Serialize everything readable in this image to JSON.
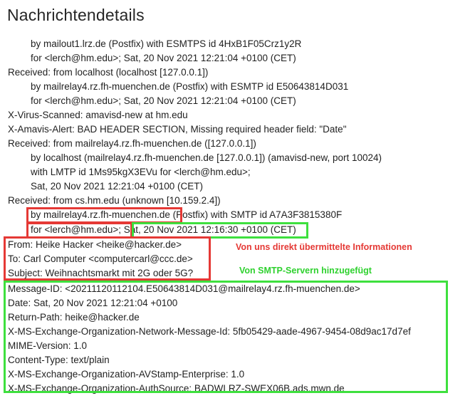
{
  "page": {
    "title": "Nachrichtendetails"
  },
  "header_lines": [
    "by mailout1.lrz.de (Postfix) with ESMTPS id 4HxB1F05Crz1y2R",
    "for <lerch@hm.edu>; Sat, 20 Nov 2021 12:21:04 +0100 (CET)",
    "Received: from localhost (localhost [127.0.0.1])",
    "by mailrelay4.rz.fh-muenchen.de (Postfix) with ESMTP id E50643814D031",
    "for <lerch@hm.edu>; Sat, 20 Nov 2021 12:21:04 +0100 (CET)",
    "X-Virus-Scanned: amavisd-new at hm.edu",
    "X-Amavis-Alert: BAD HEADER SECTION, Missing required header field: \"Date\"",
    "Received: from mailrelay4.rz.fh-muenchen.de ([127.0.0.1])",
    "by localhost (mailrelay4.rz.fh-muenchen.de [127.0.0.1]) (amavisd-new, port 10024)",
    "with LMTP id 1Ms95kgX3EVu for <lerch@hm.edu>;",
    "Sat, 20 Nov 2021 12:21:04 +0100 (CET)",
    "Received: from cs.hm.edu (unknown [10.159.2.4])",
    "by mailrelay4.rz.fh-muenchen.de (Postfix) with SMTP id A7A3F3815380F",
    "for <lerch@hm.edu>; Sat, 20 Nov 2021 12:16:30 +0100 (CET)",
    "From: Heike Hacker <heike@hacker.de>",
    "To: Carl Computer <computercarl@ccc.de>",
    "Subject: Weihnachtsmarkt mit 2G oder 5G?",
    "Message-ID: <20211120112104.E50643814D031@mailrelay4.rz.fh-muenchen.de>",
    "Date: Sat, 20 Nov 2021 12:21:04 +0100",
    "Return-Path: heike@hacker.de",
    "X-MS-Exchange-Organization-Network-Message-Id: 5fb05429-aade-4967-9454-08d9ac17d7ef",
    "MIME-Version: 1.0",
    "Content-Type: text/plain",
    "X-MS-Exchange-Organization-AVStamp-Enterprise: 1.0",
    "X-MS-Exchange-Organization-AuthSource: BADWLRZ-SWEX06B.ads.mwn.de"
  ],
  "annotations": {
    "red_label": "Von uns direkt übermittelte Informationen",
    "green_label": "Von SMTP-Servern hinzugefügt"
  },
  "colors": {
    "red": "#e53935",
    "green": "#3ee03e"
  }
}
